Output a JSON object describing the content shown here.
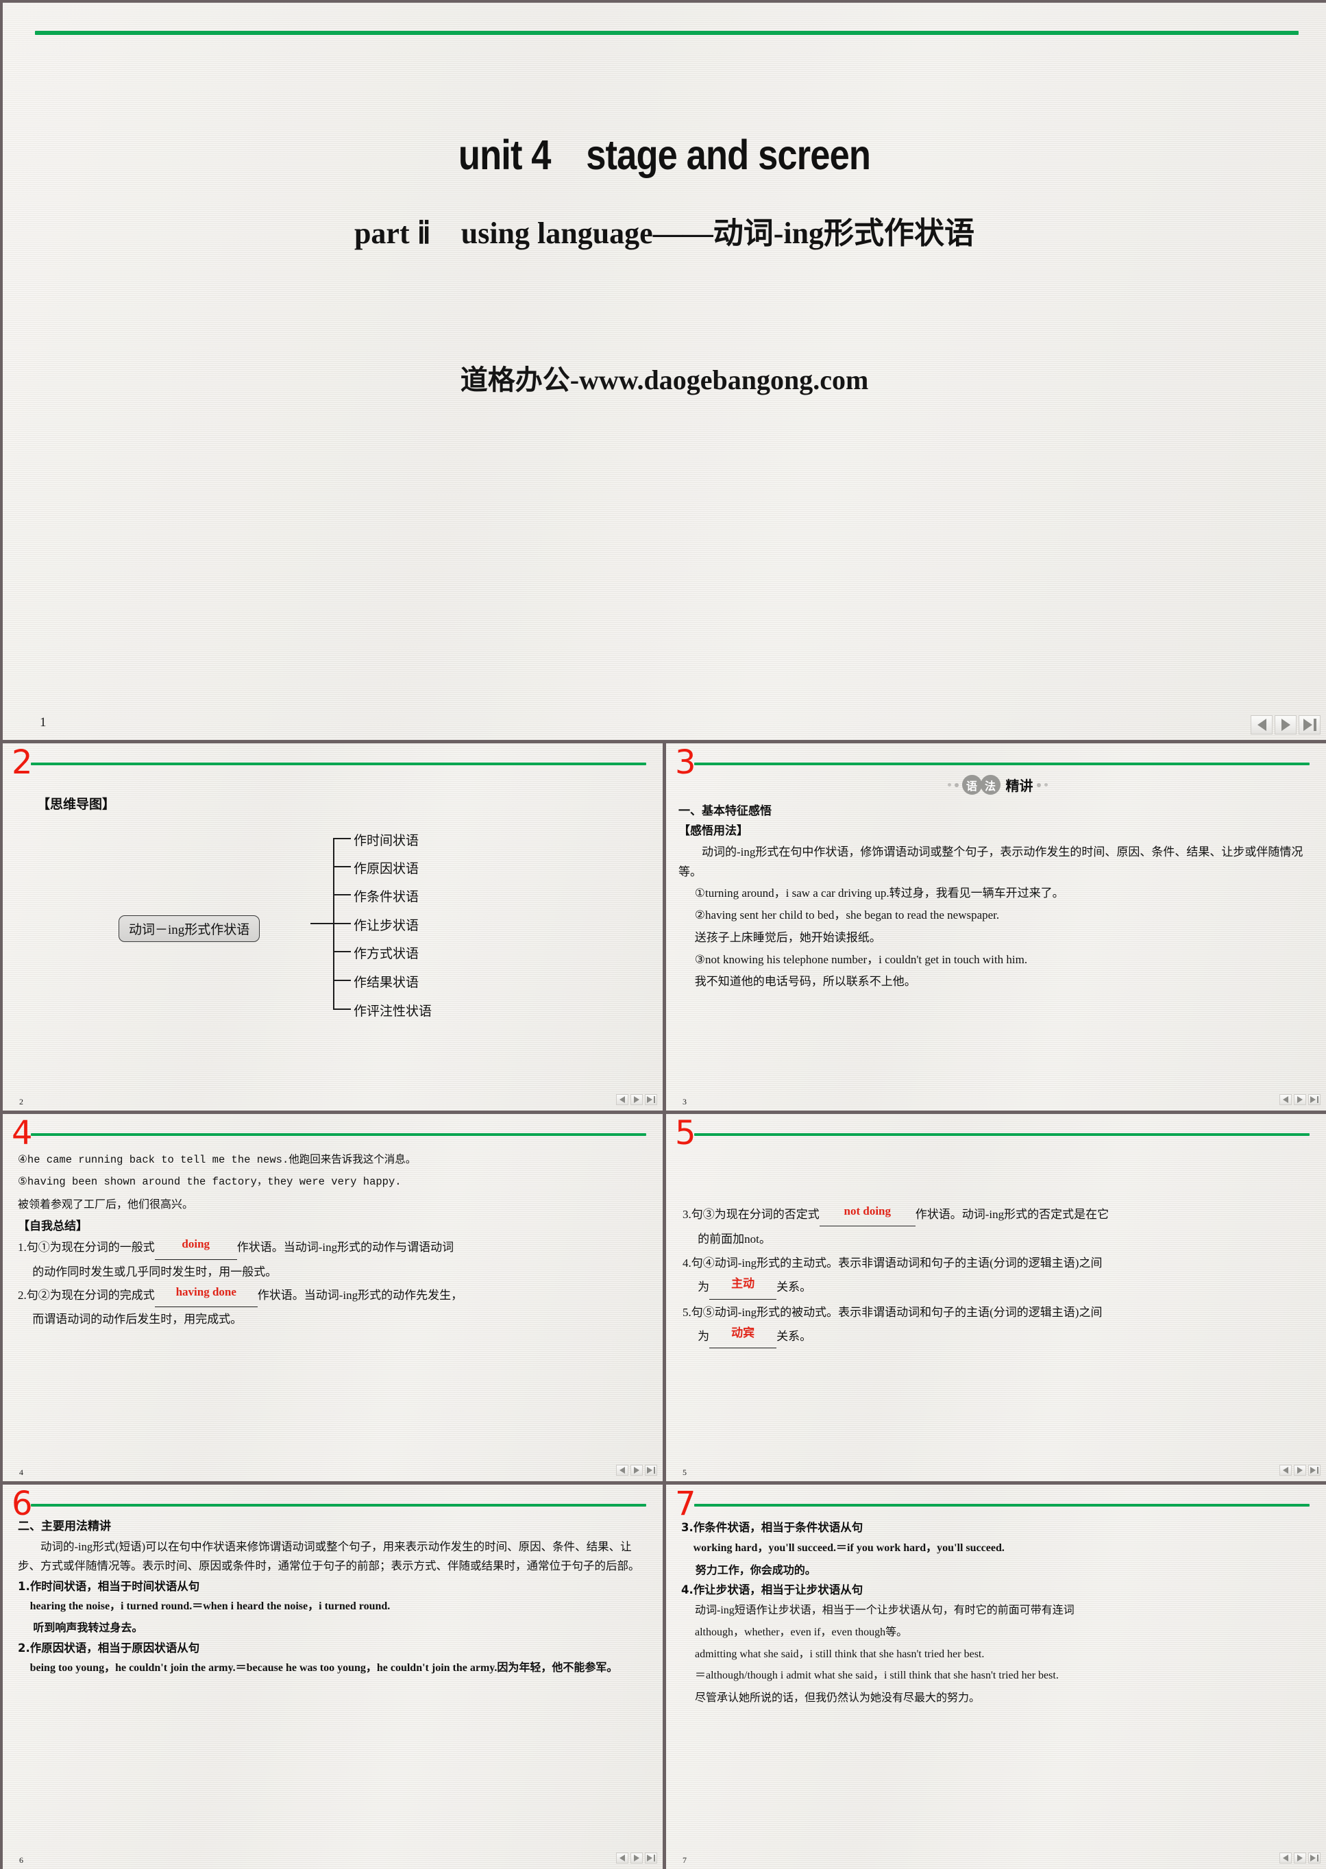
{
  "deck": {
    "nav": {
      "prev": "◀",
      "next": "▶",
      "end": "▶|"
    },
    "accent_green": "#0aa651",
    "accent_red": "#ee1b0f",
    "frame_color": "#6b6163"
  },
  "slide1": {
    "number": "1",
    "page_label": "1",
    "title": "unit 4　stage and screen",
    "subtitle": "part ⅱ　using language——动词-ing形式作状语",
    "watermark": "道格办公-www.daogebangong.com"
  },
  "slide2": {
    "number": "2",
    "page_label": "2",
    "section_label": "【思维导图】",
    "mindmap": {
      "root": "动词－ing形式作状语",
      "branches": [
        "作时间状语",
        "作原因状语",
        "作条件状语",
        "作让步状语",
        "作方式状语",
        "作结果状语",
        "作评注性状语"
      ]
    }
  },
  "slide3": {
    "number": "3",
    "page_label": "3",
    "badge": {
      "circle1": "语",
      "circle2": "法",
      "text": "精讲"
    },
    "heading": "一、基本特征感悟",
    "subheading": "【感悟用法】",
    "paragraph": "动词的-ing形式在句中作状语，修饰谓语动词或整个句子，表示动作发生的时间、原因、条件、结果、让步或伴随情况等。",
    "examples": [
      "①turning around，i saw a car driving up.转过身，我看见一辆车开过来了。",
      "②having sent her child to bed，she began to read the newspaper.",
      "送孩子上床睡觉后，她开始读报纸。",
      "③not knowing his telephone number，i couldn't get in touch with him.",
      "我不知道他的电话号码，所以联系不上他。"
    ]
  },
  "slide4": {
    "number": "4",
    "page_label": "4",
    "examples": [
      "④he came running back to tell me the news.他跑回来告诉我这个消息。",
      "⑤having been shown around the factory，they were very happy.",
      "被领着参观了工厂后，他们很高兴。"
    ],
    "subheading": "【自我总结】",
    "items": [
      {
        "lead": "1.句①为现在分词的一般式",
        "blank": "doing",
        "tail": "作状语。当动词-ing形式的动作与谓语动词",
        "cont": "的动作同时发生或几乎同时发生时，用一般式。"
      },
      {
        "lead": "2.句②为现在分词的完成式",
        "blank": "having done",
        "tail": "作状语。当动词-ing形式的动作先发生，",
        "cont": "而谓语动词的动作后发生时，用完成式。"
      }
    ]
  },
  "slide5": {
    "number": "5",
    "page_label": "5",
    "items": [
      {
        "lead": "3.句③为现在分词的否定式",
        "blank": "not doing",
        "tail": "作状语。动词-ing形式的否定式是在它",
        "cont": "的前面加not。"
      },
      {
        "lead": "4.句④动词-ing形式的主动式。表示非谓语动词和句子的主语(分词的逻辑主语)之间",
        "cont_pre": "为",
        "blank": "主动",
        "cont_post": "关系。"
      },
      {
        "lead": "5.句⑤动词-ing形式的被动式。表示非谓语动词和句子的主语(分词的逻辑主语)之间",
        "cont_pre": "为",
        "blank": "动宾",
        "cont_post": "关系。"
      }
    ]
  },
  "slide6": {
    "number": "6",
    "page_label": "6",
    "heading": "二、主要用法精讲",
    "paragraph": "动词的-ing形式(短语)可以在句中作状语来修饰谓语动词或整个句子，用来表示动作发生的时间、原因、条件、结果、让步、方式或伴随情况等。表示时间、原因或条件时，通常位于句子的前部；表示方式、伴随或结果时，通常位于句子的后部。",
    "rules": [
      {
        "title": "1.作时间状语，相当于时间状语从句",
        "english": "hearing the noise，i turned round.＝when i heard the noise，i turned round.",
        "chinese": "听到响声我转过身去。"
      },
      {
        "title": "2.作原因状语，相当于原因状语从句",
        "english": "being too young，he couldn't join the army.＝because he was too young，he couldn't join the army.因为年轻，他不能参军。",
        "chinese": ""
      }
    ]
  },
  "slide7": {
    "number": "7",
    "page_label": "7",
    "rules": [
      {
        "title": "3.作条件状语，相当于条件状语从句",
        "english": "working hard，you'll succeed.＝if you work hard，you'll succeed.",
        "chinese": "努力工作，你会成功的。"
      },
      {
        "title": "4.作让步状语，相当于让步状语从句",
        "note1": "动词-ing短语作让步状语，相当于一个让步状语从句，有时它的前面可带有连词",
        "note2": "although，whether，even if，even though等。",
        "example1": "admitting what she said，i still think that she hasn't tried her best.",
        "example2": "＝although/though i admit what she said，i still think that she hasn't tried her best.",
        "chinese": "尽管承认她所说的话，但我仍然认为她没有尽最大的努力。"
      }
    ]
  }
}
